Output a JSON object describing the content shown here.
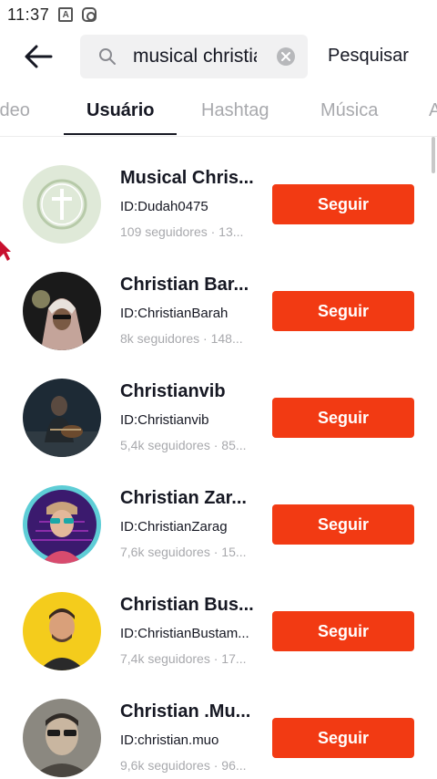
{
  "status_bar": {
    "time": "11:37",
    "icons": [
      "a-notification-icon",
      "instagram-notification-icon"
    ]
  },
  "header": {
    "back_icon": "back-arrow-icon",
    "search_value": "musical christia",
    "search_icon": "search-icon",
    "clear_icon": "clear-icon",
    "submit_label": "Pesquisar"
  },
  "tabs": [
    {
      "label": "ídeo",
      "active": false
    },
    {
      "label": "Usuário",
      "active": true
    },
    {
      "label": "Hashtag",
      "active": false
    },
    {
      "label": "Música",
      "active": false
    },
    {
      "label": "A",
      "active": false
    }
  ],
  "users": [
    {
      "name": "Musical Chris...",
      "id": "ID:Dudah0475",
      "meta": "109 seguidores · 13...",
      "follow_label": "Seguir",
      "avatar": "cross-wreath-avatar"
    },
    {
      "name": "Christian Bar...",
      "id": "ID:ChristianBarah",
      "meta": "8k seguidores · 148...",
      "follow_label": "Seguir",
      "avatar": "keffiyeh-avatar"
    },
    {
      "name": "Christianvib",
      "id": "ID:Christianvib",
      "meta": "5,4k seguidores · 85...",
      "follow_label": "Seguir",
      "avatar": "guitar-night-avatar"
    },
    {
      "name": "Christian Zar...",
      "id": "ID:ChristianZarag",
      "meta": "7,6k seguidores · 15...",
      "follow_label": "Seguir",
      "avatar": "neon-sunglasses-avatar"
    },
    {
      "name": "Christian Bus...",
      "id": "ID:ChristianBustam...",
      "meta": "7,4k seguidores · 17...",
      "follow_label": "Seguir",
      "avatar": "yellow-bg-man-avatar"
    },
    {
      "name": "Christian .Mu...",
      "id": "ID:christian.muo",
      "meta": "9,6k seguidores · 96...",
      "follow_label": "Seguir",
      "avatar": "sunglasses-selfie-avatar"
    }
  ],
  "colors": {
    "follow_button": "#f23a13",
    "active_tab": "#161823",
    "inactive_tab": "#a8a9ad",
    "search_bg": "#f1f1f2"
  }
}
